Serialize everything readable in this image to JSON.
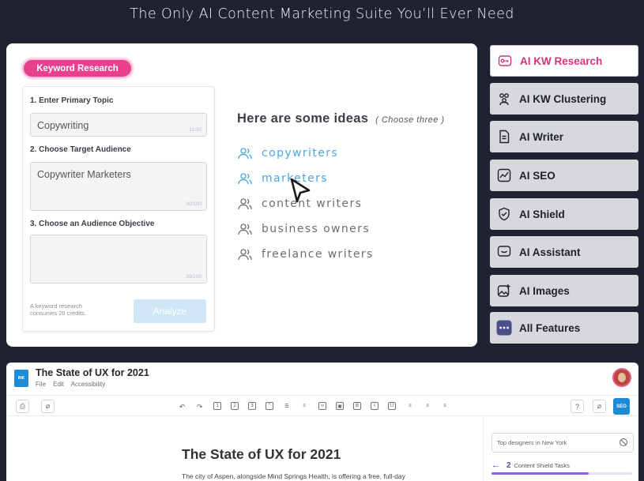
{
  "headline": "The Only AI Content Marketing Suite You’ll Ever Need",
  "demo": {
    "pill_label": "Keyword Research",
    "field1_label": "1. Enter Primary Topic",
    "field1_value": "Copywriting",
    "field1_count": "11/30",
    "field2_label": "2. Choose Target Audience",
    "field2_value": "Copywriter  Marketers",
    "field2_count": "30/100",
    "field3_label": "3. Choose an Audience Objective",
    "field3_value": "",
    "field3_count": "39/200",
    "credit_note": "A keyword research consumes 20 credits.",
    "analyze_label": "Analyze",
    "ideas_title": "Here are some ideas",
    "ideas_hint": "( Choose three )",
    "ideas": [
      {
        "label": "copywriters",
        "selected": true
      },
      {
        "label": "marketers",
        "selected": true
      },
      {
        "label": "content writers",
        "selected": false
      },
      {
        "label": "business owners",
        "selected": false
      },
      {
        "label": "freelance writers",
        "selected": false
      }
    ]
  },
  "sidebar": {
    "active_color": "#d6337f",
    "items": [
      {
        "label": "AI KW Research",
        "icon": "key-icon",
        "active": true
      },
      {
        "label": "AI KW Clustering",
        "icon": "cluster-icon",
        "active": false
      },
      {
        "label": "AI Writer",
        "icon": "document-icon",
        "active": false
      },
      {
        "label": "AI SEO",
        "icon": "chart-icon",
        "active": false
      },
      {
        "label": "AI Shield",
        "icon": "shield-icon",
        "active": false
      },
      {
        "label": "AI Assistant",
        "icon": "chat-icon",
        "active": false
      },
      {
        "label": "AI Images",
        "icon": "image-icon",
        "active": false
      },
      {
        "label": "All Features",
        "icon": "more-icon",
        "active": false
      }
    ]
  },
  "editor": {
    "logo_text": "INK",
    "doc_title": "The State of UX for 2021",
    "menu": [
      "File",
      "Edit",
      "Accessibility"
    ],
    "seo_label": "SEO",
    "heading": "The State of UX for 2021",
    "body_line": "The city of Aspen, alongside Mind Springs Health, is offering a free, full-day",
    "right_panel": {
      "search_value": "Top designers in New York",
      "tasks_count": "2",
      "tasks_label": "Content Shield Tasks",
      "progress": 0.69
    }
  }
}
